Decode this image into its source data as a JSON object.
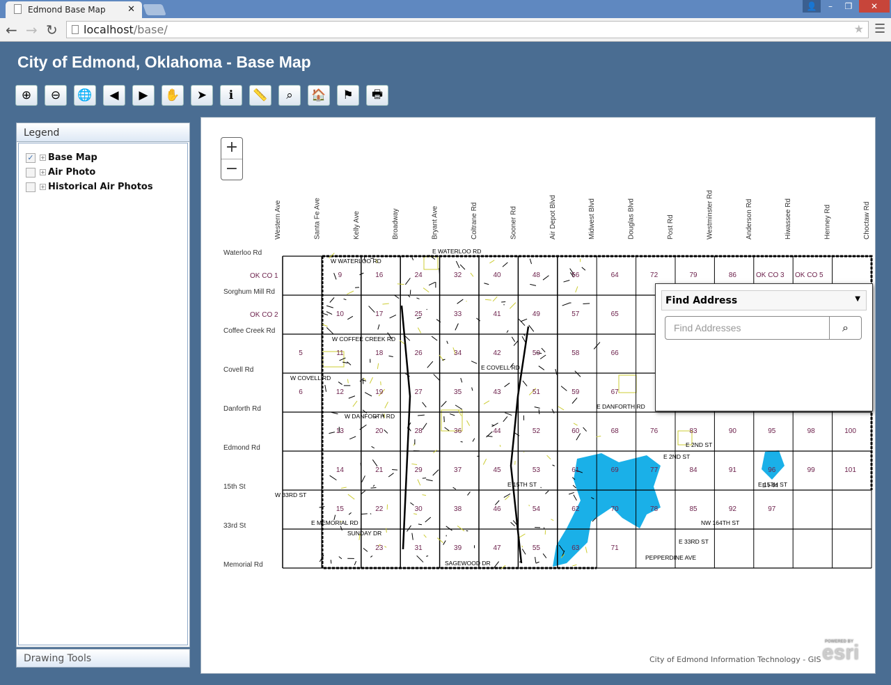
{
  "browser": {
    "tab_title": "Edmond Base Map",
    "url_host": "localhost",
    "url_path": "/base/"
  },
  "app": {
    "title": "City of Edmond, Oklahoma - Base Map"
  },
  "toolbar": [
    {
      "name": "zoom-in",
      "glyph": "⊕"
    },
    {
      "name": "zoom-out",
      "glyph": "⊖"
    },
    {
      "name": "full-extent",
      "glyph": "🌐"
    },
    {
      "name": "previous-extent",
      "glyph": "◀"
    },
    {
      "name": "next-extent",
      "glyph": "▶"
    },
    {
      "name": "pan",
      "glyph": "✋"
    },
    {
      "name": "select",
      "glyph": "➤"
    },
    {
      "name": "identify",
      "glyph": "ℹ"
    },
    {
      "name": "measure",
      "glyph": "📏"
    },
    {
      "name": "find",
      "glyph": "⌕"
    },
    {
      "name": "address-locate",
      "glyph": "🏠"
    },
    {
      "name": "route",
      "glyph": "⚑"
    },
    {
      "name": "print",
      "glyph": "🖶"
    }
  ],
  "legend": {
    "title": "Legend",
    "layers": [
      {
        "label": "Base Map",
        "checked": true
      },
      {
        "label": "Air Photo",
        "checked": false
      },
      {
        "label": "Historical Air Photos",
        "checked": false
      }
    ]
  },
  "drawing_tools": {
    "title": "Drawing Tools"
  },
  "map": {
    "zoom_in": "+",
    "zoom_out": "−",
    "ns_streets": [
      "Western Ave",
      "Santa Fe Ave",
      "Kelly Ave",
      "Broadway",
      "Bryant Ave",
      "Coltrane Rd",
      "Sooner Rd",
      "Air Depot Blvd",
      "Midwest Blvd",
      "Douglas Blvd",
      "Post Rd",
      "Westminster Rd",
      "Anderson Rd",
      "Hiwassee Rd",
      "Henney Rd",
      "Choctaw Rd"
    ],
    "ew_streets": [
      "Waterloo Rd",
      "Sorghum Mill Rd",
      "Coffee Creek Rd",
      "Covell Rd",
      "Danforth Rd",
      "Edmond Rd",
      "15th St",
      "33rd St",
      "Memorial Rd"
    ],
    "street_labels": [
      "E WATERLOO RD",
      "W WATERLOO RD",
      "W COFFEE CREEK RD",
      "E COVELL RD",
      "W COVELL RD",
      "W DANFORTH RD",
      "E DANFORTH RD",
      "E 2ND ST",
      "E 15TH ST",
      "W 33RD ST",
      "E MEMORIAL RD",
      "SUNDAY DR",
      "E 33RD ST",
      "E 2ND ST",
      "E 15TH ST",
      "NW 164TH ST",
      "SAGEWOOD DR",
      "PEPPERDINE AVE",
      "E I-44"
    ],
    "county_labels": [
      "OK CO 1",
      "OK CO 2",
      "OK CO 3",
      "OK CO 5"
    ],
    "sections": [
      [
        "",
        "9",
        "16",
        "24",
        "32",
        "40",
        "48",
        "56",
        "64",
        "72",
        "79",
        "86",
        "",
        "",
        ""
      ],
      [
        "",
        "10",
        "17",
        "25",
        "33",
        "41",
        "49",
        "57",
        "65",
        "",
        "",
        "",
        "",
        "",
        ""
      ],
      [
        "5",
        "11",
        "18",
        "26",
        "34",
        "42",
        "50",
        "58",
        "66",
        "",
        "",
        "",
        "",
        "",
        ""
      ],
      [
        "6",
        "12",
        "19",
        "27",
        "35",
        "43",
        "51",
        "59",
        "67",
        "",
        "",
        "",
        "",
        "",
        ""
      ],
      [
        "",
        "13",
        "20",
        "28",
        "36",
        "44",
        "52",
        "60",
        "68",
        "76",
        "83",
        "90",
        "95",
        "98",
        "100"
      ],
      [
        "",
        "14",
        "21",
        "29",
        "37",
        "45",
        "53",
        "61",
        "69",
        "77",
        "84",
        "91",
        "96",
        "99",
        "101"
      ],
      [
        "",
        "15",
        "22",
        "30",
        "38",
        "46",
        "54",
        "62",
        "70",
        "78",
        "85",
        "92",
        "97",
        "",
        ""
      ],
      [
        "",
        "",
        "23",
        "31",
        "39",
        "47",
        "55",
        "63",
        "71",
        "",
        "",
        "",
        "",
        "",
        ""
      ]
    ],
    "credit": "City of Edmond Information Technology - GIS",
    "esri": "esri",
    "powered_by": "POWERED BY",
    "colors": {
      "lake": "#1ab0e8",
      "roads": "#000000",
      "parks": "#cccc33",
      "sections": "#6b1f4a"
    }
  },
  "find_address": {
    "title": "Find Address",
    "placeholder": "Find Addresses"
  }
}
